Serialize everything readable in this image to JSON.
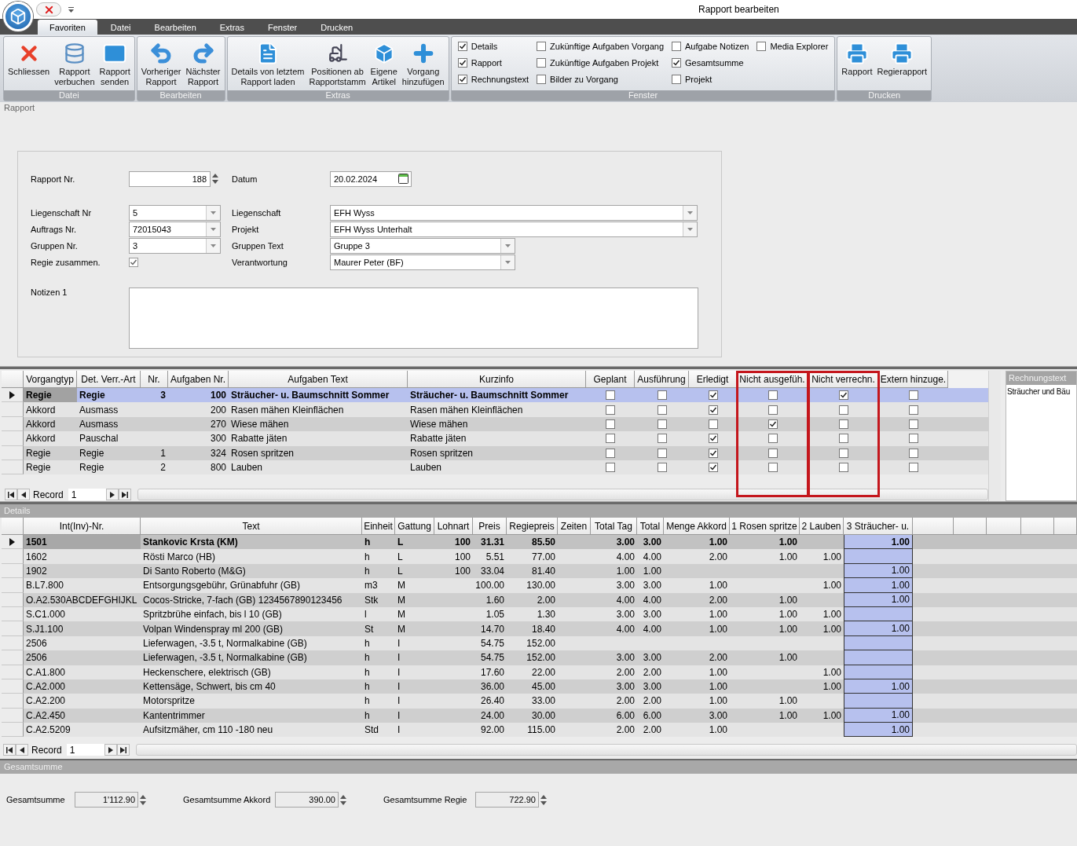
{
  "window": {
    "title": "Rapport bearbeiten"
  },
  "ribbon_tabs": [
    {
      "label": "Favoriten",
      "selected": true
    },
    {
      "label": "Datei",
      "selected": false
    },
    {
      "label": "Bearbeiten",
      "selected": false
    },
    {
      "label": "Extras",
      "selected": false
    },
    {
      "label": "Fenster",
      "selected": false
    },
    {
      "label": "Drucken",
      "selected": false
    }
  ],
  "ribbon_groups": [
    {
      "kind": "buttons",
      "title": "Datei",
      "buttons": [
        {
          "lines": [
            "Schliessen"
          ]
        },
        {
          "lines": [
            "Rapport",
            "verbuchen"
          ]
        },
        {
          "lines": [
            "Rapport",
            "senden"
          ]
        }
      ]
    },
    {
      "kind": "buttons",
      "title": "Bearbeiten",
      "buttons": [
        {
          "lines": [
            "Vorheriger",
            "Rapport"
          ]
        },
        {
          "lines": [
            "Nächster",
            "Rapport"
          ]
        }
      ]
    },
    {
      "kind": "buttons",
      "title": "Extras",
      "buttons": [
        {
          "lines": [
            "Details von letztem",
            "Rapport laden"
          ]
        },
        {
          "lines": [
            "Positionen ab",
            "Rapportstamm"
          ]
        },
        {
          "lines": [
            "Eigene",
            "Artikel"
          ]
        },
        {
          "lines": [
            "Vorgang",
            "hinzufügen"
          ]
        }
      ]
    },
    {
      "kind": "checkboxes",
      "title": "Fenster",
      "columns": [
        [
          {
            "label": "Details",
            "checked": true
          },
          {
            "label": "Rapport",
            "checked": true
          },
          {
            "label": "Rechnungstext",
            "checked": true
          }
        ],
        [
          {
            "label": "Zukünftige Aufgaben Vorgang",
            "checked": false
          },
          {
            "label": "Zukünftige Aufgaben Projekt",
            "checked": false
          },
          {
            "label": "Bilder zu Vorgang",
            "checked": false
          }
        ],
        [
          {
            "label": "Aufgabe Notizen",
            "checked": false
          },
          {
            "label": "Gesamtsumme",
            "checked": true
          },
          {
            "label": "Projekt",
            "checked": false
          }
        ],
        [
          {
            "label": "Media Explorer",
            "checked": false
          }
        ]
      ]
    },
    {
      "kind": "buttons",
      "title": "Drucken",
      "buttons": [
        {
          "lines": [
            "Rapport"
          ]
        },
        {
          "lines": [
            "Regierapport"
          ]
        }
      ]
    }
  ],
  "rapport": {
    "title": "Rapport",
    "rapport_nr": {
      "label": "Rapport Nr.",
      "value": "188"
    },
    "datum": {
      "label": "Datum",
      "value": "20.02.2024"
    },
    "rows": [
      {
        "left": {
          "label": "Liegenschaft Nr",
          "value": "5"
        },
        "right": {
          "label": "Liegenschaft",
          "value": "EFH Wyss"
        }
      },
      {
        "left": {
          "label": "Auftrags Nr.",
          "value": "72015043"
        },
        "right": {
          "label": "Projekt",
          "value": "EFH Wyss Unterhalt"
        }
      },
      {
        "left": {
          "label": "Gruppen Nr.",
          "value": "3"
        },
        "right": {
          "label": "Gruppen Text",
          "value": "Gruppe 3"
        }
      }
    ],
    "regie": {
      "label": "Regie zusammen.",
      "checked": true
    },
    "verantwortung": {
      "label": "Verantwortung",
      "value": "Maurer Peter (BF)"
    },
    "notizen": {
      "label": "Notizen 1"
    }
  },
  "tasks": {
    "text_columns": [
      {
        "label": "Vorgangtyp"
      },
      {
        "label": "Det. Verr.-Art"
      },
      {
        "label": "Nr."
      },
      {
        "label": "Aufgaben Nr."
      },
      {
        "label": "Aufgaben Text"
      },
      {
        "label": "Kurzinfo"
      }
    ],
    "check_columns": [
      {
        "label": "Geplant",
        "highlighted": false
      },
      {
        "label": "Ausführung",
        "highlighted": false
      },
      {
        "label": "Erledigt",
        "highlighted": false
      },
      {
        "label": "Nicht ausgefüh.",
        "highlighted": true
      },
      {
        "label": "Nicht verrechn.",
        "highlighted": true
      },
      {
        "label": "Extern hinzuge.",
        "highlighted": false
      }
    ],
    "rows": [
      {
        "selected": true,
        "cells": [
          "Regie",
          "Regie",
          "3",
          "100",
          "Sträucher- u. Baumschnitt Sommer",
          "Sträucher- u. Baumschnitt Sommer"
        ],
        "checks": [
          false,
          false,
          true,
          false,
          true,
          false
        ]
      },
      {
        "selected": false,
        "cells": [
          "Akkord",
          "Ausmass",
          null,
          "200",
          "Rasen mähen Kleinflächen",
          "Rasen mähen Kleinflächen"
        ],
        "checks": [
          false,
          false,
          true,
          false,
          false,
          false
        ]
      },
      {
        "selected": false,
        "cells": [
          "Akkord",
          "Ausmass",
          null,
          "270",
          "Wiese mähen",
          "Wiese mähen"
        ],
        "checks": [
          false,
          false,
          false,
          true,
          false,
          false
        ]
      },
      {
        "selected": false,
        "cells": [
          "Akkord",
          "Pauschal",
          null,
          "300",
          "Rabatte jäten",
          "Rabatte jäten"
        ],
        "checks": [
          false,
          false,
          true,
          false,
          false,
          false
        ]
      },
      {
        "selected": false,
        "cells": [
          "Regie",
          "Regie",
          "1",
          "324",
          "Rosen spritzen",
          "Rosen spritzen"
        ],
        "checks": [
          false,
          false,
          true,
          false,
          false,
          false
        ]
      },
      {
        "selected": false,
        "cells": [
          "Regie",
          "Regie",
          "2",
          "800",
          "Lauben",
          "Lauben"
        ],
        "checks": [
          false,
          false,
          true,
          false,
          false,
          false
        ]
      }
    ],
    "navigator": {
      "label": "Record",
      "value": "1"
    }
  },
  "rechnungstext": {
    "title": "Rechnungstext",
    "text": "Sträucher und Bäu"
  },
  "details": {
    "title": "Details",
    "columns": [
      {
        "label": "Int(Inv)-Nr."
      },
      {
        "label": "Text"
      },
      {
        "label": "Einheit"
      },
      {
        "label": "Gattung"
      },
      {
        "label": "Lohnart"
      },
      {
        "label": "Preis"
      },
      {
        "label": "Regiepreis"
      },
      {
        "label": "Zeiten"
      },
      {
        "label": "Total Tag"
      },
      {
        "label": "Total"
      },
      {
        "label": "Menge Akkord"
      },
      {
        "label": "1 Rosen spritze"
      },
      {
        "label": "2 Lauben"
      },
      {
        "label": "3 Sträucher- u.",
        "highlighted": true
      }
    ],
    "rows": [
      {
        "selected": true,
        "cells": [
          "1501",
          "Stankovic Krsta (KM)",
          "h",
          "L",
          "100",
          "31.31",
          "85.50",
          null,
          "3.00",
          "3.00",
          "1.00",
          "1.00",
          null,
          "1.00"
        ]
      },
      {
        "selected": false,
        "cells": [
          "1602",
          "Rösti Marco (HB)",
          "h",
          "L",
          "100",
          "5.51",
          "77.00",
          null,
          "4.00",
          "4.00",
          "2.00",
          "1.00",
          "1.00",
          null
        ]
      },
      {
        "selected": false,
        "cells": [
          "1902",
          "Di Santo Roberto (M&G)",
          "h",
          "L",
          "100",
          "33.04",
          "81.40",
          null,
          "1.00",
          "1.00",
          null,
          null,
          null,
          "1.00"
        ]
      },
      {
        "selected": false,
        "cells": [
          "B.L7.800",
          "Entsorgungsgebühr, Grünabfuhr (GB)",
          "m3",
          "M",
          null,
          "100.00",
          "130.00",
          null,
          "3.00",
          "3.00",
          "1.00",
          null,
          "1.00",
          "1.00"
        ]
      },
      {
        "selected": false,
        "cells": [
          "O.A2.530ABCDEFGHIJKL",
          "Cocos-Stricke, 7-fach (GB) 1234567890123456",
          "Stk",
          "M",
          null,
          "1.60",
          "2.00",
          null,
          "4.00",
          "4.00",
          "2.00",
          "1.00",
          null,
          "1.00"
        ]
      },
      {
        "selected": false,
        "cells": [
          "S.C1.000",
          "Spritzbrühe einfach, bis l 10 (GB)",
          "l",
          "M",
          null,
          "1.05",
          "1.30",
          null,
          "3.00",
          "3.00",
          "1.00",
          "1.00",
          "1.00",
          null
        ]
      },
      {
        "selected": false,
        "cells": [
          "S.J1.100",
          "Volpan Windenspray ml 200 (GB)",
          "St",
          "M",
          null,
          "14.70",
          "18.40",
          null,
          "4.00",
          "4.00",
          "1.00",
          "1.00",
          "1.00",
          "1.00"
        ]
      },
      {
        "selected": false,
        "cells": [
          "2506",
          "Lieferwagen, -3.5 t, Normalkabine (GB)",
          "h",
          "I",
          null,
          "54.75",
          "152.00",
          null,
          null,
          null,
          null,
          null,
          null,
          null
        ]
      },
      {
        "selected": false,
        "cells": [
          "2506",
          "Lieferwagen, -3.5 t, Normalkabine (GB)",
          "h",
          "I",
          null,
          "54.75",
          "152.00",
          null,
          "3.00",
          "3.00",
          "2.00",
          "1.00",
          null,
          null
        ]
      },
      {
        "selected": false,
        "cells": [
          "C.A1.800",
          "Heckenschere, elektrisch (GB)",
          "h",
          "I",
          null,
          "17.60",
          "22.00",
          null,
          "2.00",
          "2.00",
          "1.00",
          null,
          "1.00",
          null
        ]
      },
      {
        "selected": false,
        "cells": [
          "C.A2.000",
          "Kettensäge, Schwert, bis cm 40",
          "h",
          "I",
          null,
          "36.00",
          "45.00",
          null,
          "3.00",
          "3.00",
          "1.00",
          null,
          "1.00",
          "1.00"
        ]
      },
      {
        "selected": false,
        "cells": [
          "C.A2.200",
          "Motorspritze",
          "h",
          "I",
          null,
          "26.40",
          "33.00",
          null,
          "2.00",
          "2.00",
          "1.00",
          "1.00",
          null,
          null
        ]
      },
      {
        "selected": false,
        "cells": [
          "C.A2.450",
          "Kantentrimmer",
          "h",
          "I",
          null,
          "24.00",
          "30.00",
          null,
          "6.00",
          "6.00",
          "3.00",
          "1.00",
          "1.00",
          "1.00"
        ]
      },
      {
        "selected": false,
        "cells": [
          "C.A2.5209",
          "Aufsitzmäher, cm 110 -180 neu",
          "Std",
          "I",
          null,
          "92.00",
          "115.00",
          null,
          "2.00",
          "2.00",
          "1.00",
          null,
          null,
          "1.00"
        ]
      }
    ],
    "navigator": {
      "label": "Record",
      "value": "1"
    }
  },
  "gesamtsumme": {
    "title": "Gesamtsumme",
    "fields": [
      {
        "label": "Gesamtsumme",
        "value": "1'112.90"
      },
      {
        "label": "Gesamtsumme Akkord",
        "value": "390.00"
      },
      {
        "label": "Gesamtsumme Regie",
        "value": "722.90"
      }
    ]
  }
}
